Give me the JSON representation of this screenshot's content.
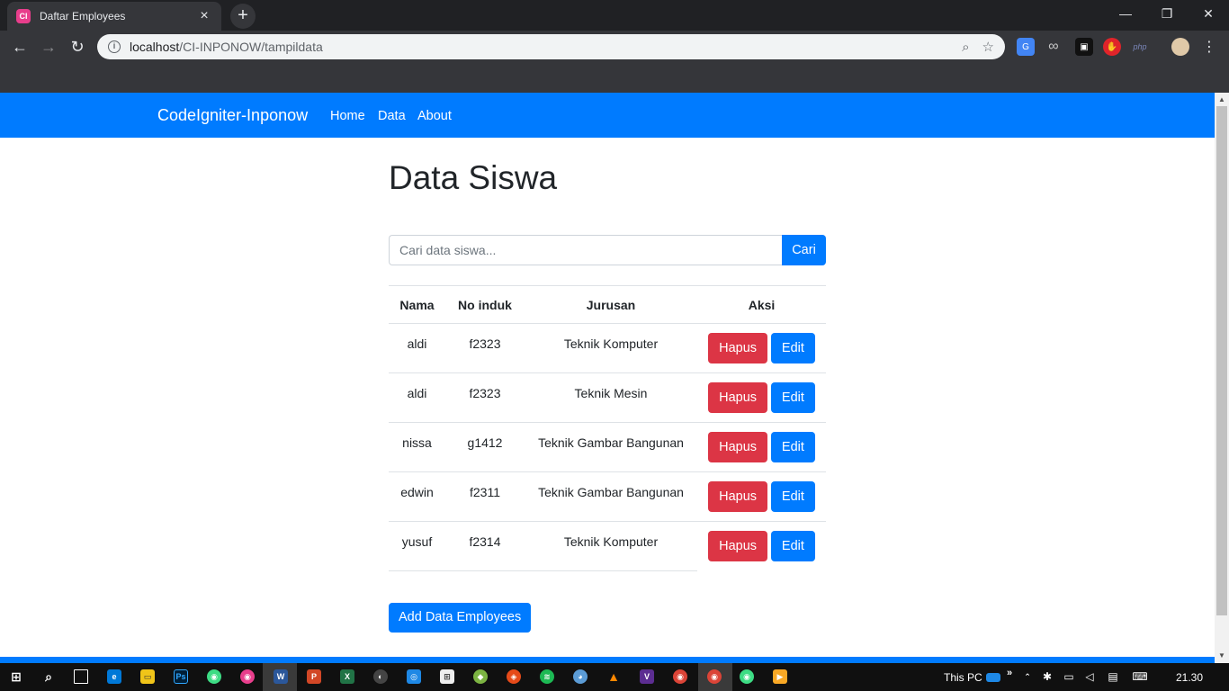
{
  "browser": {
    "tab_title": "Daftar Employees",
    "tab_favicon": "CI",
    "tab_close": "×",
    "new_tab": "+",
    "url_host": "localhost",
    "url_path": "/CI-INPONOW/tampildata",
    "win_min": "—",
    "win_restore": "❐",
    "win_close": "✕"
  },
  "navbar": {
    "brand": "CodeIgniter-Inponow",
    "links": [
      "Home",
      "Data",
      "About"
    ]
  },
  "main": {
    "title": "Data Siswa",
    "search_placeholder": "Cari data siswa...",
    "search_button": "Cari",
    "table": {
      "headers": [
        "Nama",
        "No induk",
        "Jurusan",
        "Aksi"
      ],
      "rows": [
        {
          "nama": "aldi",
          "no_induk": "f2323",
          "jurusan": "Teknik Komputer"
        },
        {
          "nama": "aldi",
          "no_induk": "f2323",
          "jurusan": "Teknik Mesin"
        },
        {
          "nama": "nissa",
          "no_induk": "g1412",
          "jurusan": "Teknik Gambar Bangunan"
        },
        {
          "nama": "edwin",
          "no_induk": "f2311",
          "jurusan": "Teknik Gambar Bangunan"
        },
        {
          "nama": "yusuf",
          "no_induk": "f2314",
          "jurusan": "Teknik Komputer"
        }
      ],
      "delete_label": "Hapus",
      "edit_label": "Edit"
    },
    "add_button": "Add Data Employees"
  },
  "taskbar": {
    "this_pc": "This PC",
    "clock": "21.30"
  },
  "colors": {
    "primary": "#007bff",
    "danger": "#dc3545",
    "chrome_dark": "#35363a"
  }
}
